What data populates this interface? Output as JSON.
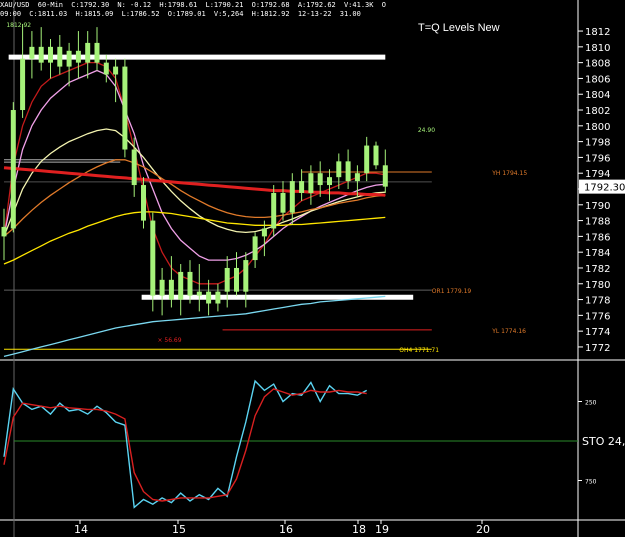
{
  "header": {
    "symbol": "XAU/USD",
    "interval": "60-Min",
    "fields": [
      "C:1792.30",
      "N: -0.12",
      "H:1798.61",
      "L:1790.21",
      "O:1792.68",
      "A:1792.62",
      "V:41.3K",
      "O"
    ],
    "row2_fields": [
      "09:00",
      "C:1811.03",
      "H:1815.09",
      "L:1786.52",
      "O:1789.01",
      "V:5,264",
      "H:1812.92",
      "12-13-22",
      "31.00"
    ]
  },
  "title": "T=Q Levels New",
  "colors": {
    "background": "#000000",
    "axis": "#ffffff",
    "candle_up": "#a6f27a",
    "ema_red": "#c41b1b",
    "ema_thick_red": "#e02020",
    "ema_pink": "#f0a0e8",
    "ema_lightyellow": "#f4f4b0",
    "ema_orange": "#e07a2a",
    "ema_yellow": "#ffe600",
    "ema_cyan": "#7ad8f0",
    "level_white": "#ffffff",
    "stoch_k": "#5bd4f2",
    "stoch_d": "#d82020",
    "stoch_mid": "#2a8a2a"
  },
  "chart_data": [
    {
      "type": "line",
      "panel": "price",
      "ylim": [
        1770.6,
        1813.4
      ],
      "y_ticks": [
        1812,
        1810,
        1808,
        1806,
        1804,
        1802,
        1800,
        1798,
        1796,
        1794,
        1792,
        1790,
        1788,
        1786,
        1784,
        1782,
        1780,
        1778,
        1776,
        1774,
        1772
      ],
      "x_ticks": [
        "14",
        "15",
        "16",
        "18",
        "19",
        "20"
      ],
      "last_price_label": "1792.30",
      "annotations": [
        {
          "text": "1812.92",
          "x": 0.25,
          "y": 1812.9
        },
        {
          "text": "24.90",
          "x": 44.5,
          "y": 1799.6
        },
        {
          "text": "YH 1794.15",
          "x": 52.5,
          "y": 1794.15,
          "color": "#e07a2a"
        },
        {
          "text": "OR1 1779.19",
          "x": 46.0,
          "y": 1779.19,
          "color": "#e07a2a"
        },
        {
          "text": "YL 1774.16",
          "x": 52.5,
          "y": 1774.16,
          "color": "#e07a2a"
        },
        {
          "text": "OH4 1771.71",
          "x": 42.5,
          "y": 1771.71,
          "color": "#ffe600"
        },
        {
          "text": "× 56.69",
          "x": 16.5,
          "y": 1773.0,
          "color": "#e02020"
        }
      ],
      "levels": [
        {
          "name": "white-upper",
          "y": 1808.7,
          "x_start": 0.5,
          "x_end": 41.0,
          "color": "#ffffff"
        },
        {
          "name": "white-lower",
          "y": 1778.3,
          "x_start": 14.8,
          "x_end": 44.0,
          "color": "#ffffff"
        },
        {
          "name": "YH",
          "y": 1794.15,
          "x_start": 32.0,
          "x_end": 46.0,
          "color": "#e07a2a"
        },
        {
          "name": "OR1",
          "y": 1779.19,
          "x_start": 0.0,
          "x_end": 46.0,
          "color": "#606060"
        },
        {
          "name": "YL",
          "y": 1774.16,
          "x_start": 23.5,
          "x_end": 46.0,
          "color": "#e02020"
        },
        {
          "name": "OH4",
          "y": 1771.71,
          "x_start": 0.0,
          "x_end": 46.0,
          "color": "#ffe600"
        },
        {
          "name": "gray-1",
          "y": 1795.7,
          "x_start": 0.0,
          "x_end": 12.5,
          "color": "#b0b0b0"
        },
        {
          "name": "gray-2",
          "y": 1795.4,
          "x_start": 0.0,
          "x_end": 12.5,
          "color": "#b0b0b0"
        },
        {
          "name": "gray-3",
          "y": 1792.9,
          "x_start": 0.0,
          "x_end": 46.0,
          "color": "#505050"
        }
      ],
      "candles": [
        {
          "o": 1786.0,
          "h": 1789.5,
          "l": 1783.0,
          "c": 1787.2
        },
        {
          "o": 1787.0,
          "h": 1803.0,
          "l": 1786.5,
          "c": 1802.0
        },
        {
          "o": 1802.0,
          "h": 1812.9,
          "l": 1801.0,
          "c": 1808.5
        },
        {
          "o": 1808.5,
          "h": 1812.0,
          "l": 1806.0,
          "c": 1810.0
        },
        {
          "o": 1810.0,
          "h": 1812.5,
          "l": 1807.0,
          "c": 1808.0
        },
        {
          "o": 1808.0,
          "h": 1811.0,
          "l": 1806.0,
          "c": 1810.0
        },
        {
          "o": 1810.0,
          "h": 1811.5,
          "l": 1806.5,
          "c": 1807.5
        },
        {
          "o": 1807.5,
          "h": 1810.5,
          "l": 1805.0,
          "c": 1809.5
        },
        {
          "o": 1809.5,
          "h": 1812.0,
          "l": 1806.0,
          "c": 1808.0
        },
        {
          "o": 1808.0,
          "h": 1812.0,
          "l": 1806.0,
          "c": 1810.5
        },
        {
          "o": 1810.5,
          "h": 1812.5,
          "l": 1807.0,
          "c": 1808.0
        },
        {
          "o": 1808.0,
          "h": 1809.0,
          "l": 1805.5,
          "c": 1806.5
        },
        {
          "o": 1806.5,
          "h": 1808.5,
          "l": 1803.0,
          "c": 1807.5
        },
        {
          "o": 1807.5,
          "h": 1808.5,
          "l": 1796.0,
          "c": 1797.0
        },
        {
          "o": 1797.0,
          "h": 1798.5,
          "l": 1791.0,
          "c": 1792.5
        },
        {
          "o": 1792.5,
          "h": 1793.5,
          "l": 1787.0,
          "c": 1788.0
        },
        {
          "o": 1788.0,
          "h": 1789.0,
          "l": 1776.5,
          "c": 1778.5
        },
        {
          "o": 1778.5,
          "h": 1782.0,
          "l": 1776.0,
          "c": 1780.5
        },
        {
          "o": 1780.5,
          "h": 1783.5,
          "l": 1777.0,
          "c": 1778.0
        },
        {
          "o": 1778.0,
          "h": 1782.5,
          "l": 1776.0,
          "c": 1781.5
        },
        {
          "o": 1781.5,
          "h": 1783.0,
          "l": 1777.5,
          "c": 1778.5
        },
        {
          "o": 1778.5,
          "h": 1782.5,
          "l": 1776.5,
          "c": 1779.0
        },
        {
          "o": 1779.0,
          "h": 1780.5,
          "l": 1776.0,
          "c": 1777.5
        },
        {
          "o": 1777.5,
          "h": 1780.0,
          "l": 1776.5,
          "c": 1779.0
        },
        {
          "o": 1779.0,
          "h": 1783.5,
          "l": 1777.0,
          "c": 1782.0
        },
        {
          "o": 1782.0,
          "h": 1784.0,
          "l": 1778.5,
          "c": 1779.0
        },
        {
          "o": 1779.0,
          "h": 1784.0,
          "l": 1777.0,
          "c": 1783.0
        },
        {
          "o": 1783.0,
          "h": 1786.5,
          "l": 1782.0,
          "c": 1786.0
        },
        {
          "o": 1786.0,
          "h": 1788.0,
          "l": 1783.5,
          "c": 1787.0
        },
        {
          "o": 1787.0,
          "h": 1792.5,
          "l": 1786.0,
          "c": 1791.5
        },
        {
          "o": 1791.5,
          "h": 1793.0,
          "l": 1788.0,
          "c": 1789.0
        },
        {
          "o": 1789.0,
          "h": 1794.0,
          "l": 1787.5,
          "c": 1793.0
        },
        {
          "o": 1793.0,
          "h": 1794.5,
          "l": 1790.5,
          "c": 1791.5
        },
        {
          "o": 1791.5,
          "h": 1795.0,
          "l": 1790.0,
          "c": 1794.0
        },
        {
          "o": 1794.0,
          "h": 1795.5,
          "l": 1791.0,
          "c": 1792.5
        },
        {
          "o": 1792.5,
          "h": 1794.5,
          "l": 1790.5,
          "c": 1793.5
        },
        {
          "o": 1793.5,
          "h": 1796.5,
          "l": 1792.0,
          "c": 1795.5
        },
        {
          "o": 1795.5,
          "h": 1797.0,
          "l": 1792.0,
          "c": 1793.0
        },
        {
          "o": 1793.0,
          "h": 1795.0,
          "l": 1791.0,
          "c": 1794.0
        },
        {
          "o": 1794.0,
          "h": 1798.6,
          "l": 1793.0,
          "c": 1797.5
        },
        {
          "o": 1797.5,
          "h": 1798.0,
          "l": 1794.5,
          "c": 1795.0
        },
        {
          "o": 1795.0,
          "h": 1797.0,
          "l": 1791.5,
          "c": 1792.3
        }
      ],
      "series": [
        {
          "color": "#c41b1b",
          "values": [
            1786,
            1795,
            1800,
            1803,
            1805,
            1806,
            1806.5,
            1807,
            1807.5,
            1808,
            1808,
            1807.5,
            1806,
            1802,
            1797,
            1792,
            1787,
            1784,
            1782,
            1781,
            1780.5,
            1780,
            1780,
            1780,
            1780.5,
            1781,
            1782,
            1783.5,
            1785,
            1787,
            1788.5,
            1789.5,
            1790.5,
            1791,
            1791.5,
            1792,
            1792.5,
            1793,
            1793.5,
            1794,
            1794,
            1793.8
          ]
        },
        {
          "color": "#f0a0e8",
          "values": [
            1786,
            1792,
            1797,
            1800,
            1802,
            1803.5,
            1804.5,
            1805.5,
            1806,
            1806.5,
            1807,
            1806.5,
            1805,
            1802,
            1799,
            1795,
            1792,
            1789,
            1787,
            1785.5,
            1784.5,
            1783.5,
            1783,
            1783,
            1783,
            1783.2,
            1783.6,
            1784.2,
            1785,
            1786,
            1787,
            1787.8,
            1788.5,
            1789.2,
            1789.8,
            1790.3,
            1790.8,
            1791.3,
            1791.8,
            1792.2,
            1792.5,
            1792.6
          ]
        },
        {
          "color": "#f4f4b0",
          "values": [
            1786,
            1789,
            1792,
            1794,
            1795.5,
            1796.5,
            1797.3,
            1798,
            1798.5,
            1799,
            1799.4,
            1799.6,
            1799.4,
            1798.5,
            1797.3,
            1796,
            1794.5,
            1793,
            1791.7,
            1790.5,
            1789.5,
            1788.6,
            1787.9,
            1787.3,
            1786.9,
            1786.6,
            1786.5,
            1786.6,
            1786.9,
            1787.3,
            1787.8,
            1788.2,
            1788.7,
            1789.2,
            1789.6,
            1790,
            1790.4,
            1790.7,
            1791,
            1791.3,
            1791.5,
            1791.6
          ]
        },
        {
          "color": "#e07a2a",
          "values": [
            1786,
            1787,
            1788.2,
            1789.3,
            1790.3,
            1791.2,
            1792,
            1792.8,
            1793.5,
            1794.2,
            1794.8,
            1795.3,
            1795.7,
            1795.7,
            1795.3,
            1794.8,
            1794.1,
            1793.3,
            1792.6,
            1791.8,
            1791.1,
            1790.5,
            1789.9,
            1789.4,
            1789,
            1788.7,
            1788.5,
            1788.4,
            1788.4,
            1788.5,
            1788.7,
            1788.9,
            1789.1,
            1789.4,
            1789.6,
            1789.9,
            1790.2,
            1790.4,
            1790.6,
            1790.9,
            1791.1,
            1791.2
          ]
        },
        {
          "color": "#ffe600",
          "values": [
            1782.5,
            1783,
            1783.6,
            1784.2,
            1784.8,
            1785.4,
            1785.9,
            1786.4,
            1786.8,
            1787.3,
            1787.7,
            1788.1,
            1788.5,
            1788.8,
            1789,
            1789.1,
            1789.1,
            1789,
            1788.9,
            1788.7,
            1788.5,
            1788.3,
            1788.1,
            1787.9,
            1787.7,
            1787.6,
            1787.5,
            1787.4,
            1787.4,
            1787.4,
            1787.4,
            1787.5,
            1787.5,
            1787.6,
            1787.7,
            1787.8,
            1787.9,
            1788,
            1788.1,
            1788.2,
            1788.3,
            1788.4
          ]
        },
        {
          "color": "#7ad8f0",
          "values": [
            1770.8,
            1771.1,
            1771.4,
            1771.7,
            1772,
            1772.3,
            1772.6,
            1772.9,
            1773.2,
            1773.5,
            1773.8,
            1774.1,
            1774.4,
            1774.6,
            1774.8,
            1775,
            1775.2,
            1775.3,
            1775.4,
            1775.5,
            1775.6,
            1775.7,
            1775.8,
            1775.9,
            1776,
            1776.1,
            1776.2,
            1776.4,
            1776.6,
            1776.8,
            1777,
            1777.2,
            1777.4,
            1777.5,
            1777.7,
            1777.8,
            1777.9,
            1778,
            1778.1,
            1778.2,
            1778.3,
            1778.4
          ]
        },
        {
          "color": "#e02020",
          "thick": true,
          "values": [
            1794.7,
            1794.6,
            1794.5,
            1794.4,
            1794.3,
            1794.2,
            1794.1,
            1794,
            1793.9,
            1793.8,
            1793.7,
            1793.6,
            1793.5,
            1793.4,
            1793.3,
            1793.2,
            1793.1,
            1793,
            1792.9,
            1792.8,
            1792.7,
            1792.6,
            1792.5,
            1792.4,
            1792.3,
            1792.2,
            1792.1,
            1792,
            1791.9,
            1791.8,
            1791.8,
            1791.7,
            1791.7,
            1791.6,
            1791.6,
            1791.5,
            1791.5,
            1791.4,
            1791.4,
            1791.3,
            1791.3,
            1791.2
          ]
        }
      ]
    },
    {
      "type": "line",
      "panel": "stochastic",
      "ylim": [
        0,
        1000
      ],
      "y_ticks": [
        {
          "label": "250",
          "v": 250
        },
        {
          "label": "750",
          "v": 750
        }
      ],
      "label": "STO 24,",
      "midline": 500,
      "series": [
        {
          "color": "#5bd4f2",
          "values": [
            600,
            170,
            260,
            300,
            280,
            330,
            260,
            310,
            300,
            330,
            280,
            320,
            380,
            400,
            920,
            870,
            900,
            860,
            890,
            830,
            880,
            840,
            870,
            800,
            850,
            600,
            380,
            120,
            180,
            140,
            250,
            200,
            210,
            130,
            250,
            150,
            200,
            200,
            210,
            180
          ]
        },
        {
          "color": "#d82020",
          "values": [
            650,
            350,
            260,
            270,
            280,
            290,
            280,
            290,
            295,
            300,
            300,
            310,
            330,
            360,
            700,
            820,
            870,
            880,
            870,
            860,
            860,
            860,
            860,
            850,
            840,
            740,
            560,
            340,
            220,
            170,
            190,
            210,
            200,
            180,
            190,
            190,
            180,
            190,
            190,
            200
          ]
        }
      ]
    }
  ]
}
